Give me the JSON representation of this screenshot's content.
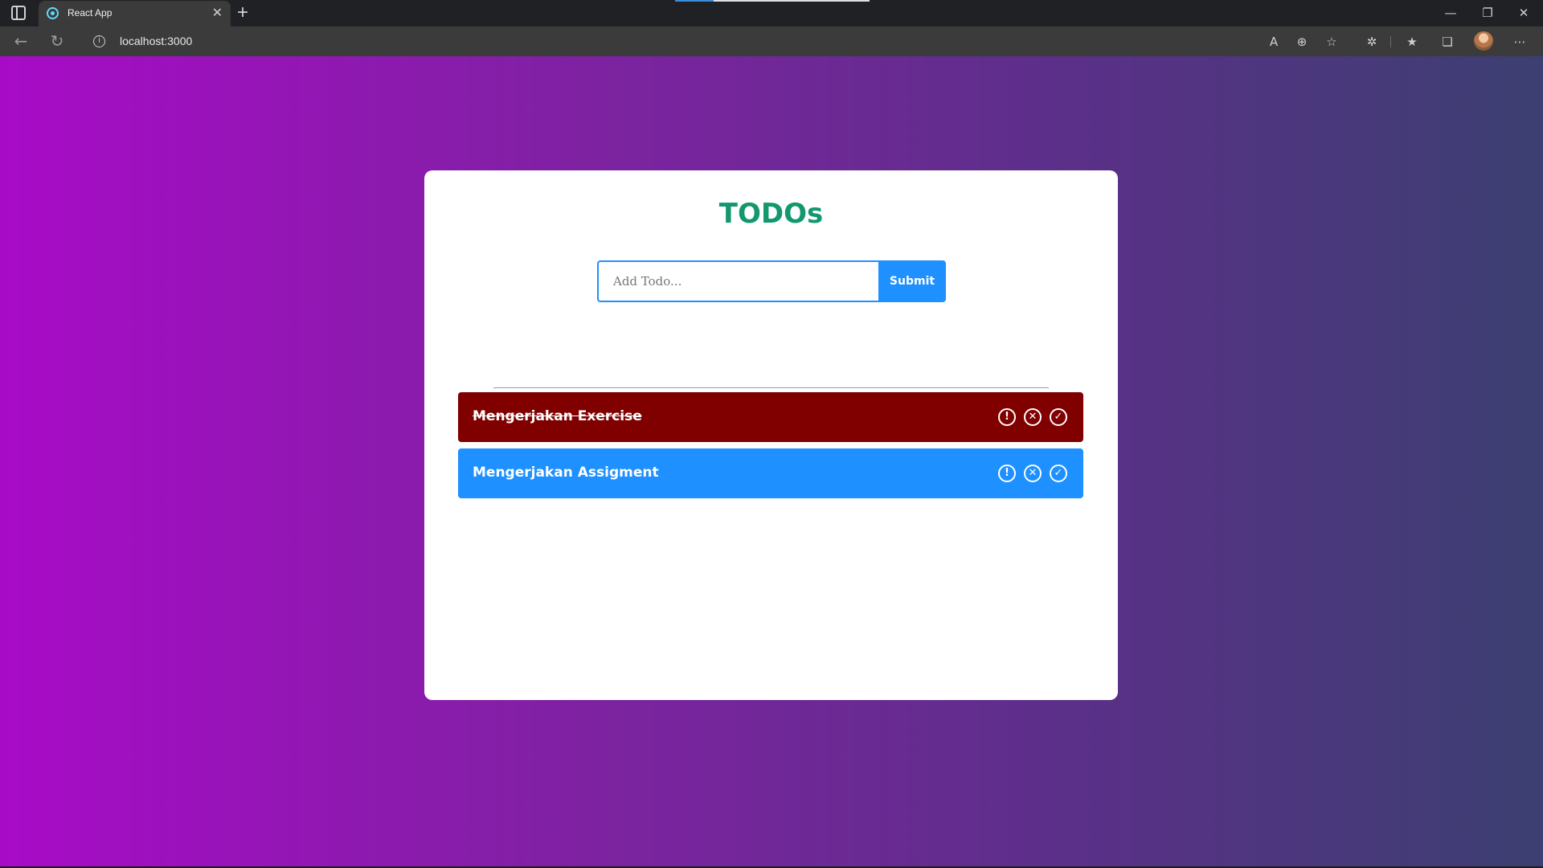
{
  "browser": {
    "tab_title": "React App",
    "url": "localhost:3000"
  },
  "app": {
    "title": "TODOs",
    "input": {
      "value": "",
      "placeholder": "Add Todo..."
    },
    "submit_label": "Submit",
    "todos": [
      {
        "text": "Mengerjakan Exercise",
        "completed": true,
        "color": "#800000"
      },
      {
        "text": "Mengerjakan Assigment",
        "completed": false,
        "color": "#1e90ff"
      }
    ]
  },
  "colors": {
    "title": "#13976f",
    "accent": "#1e90ff",
    "completed_item": "#800000",
    "background_start": "#a80bc7",
    "background_end": "#3c3f71"
  }
}
